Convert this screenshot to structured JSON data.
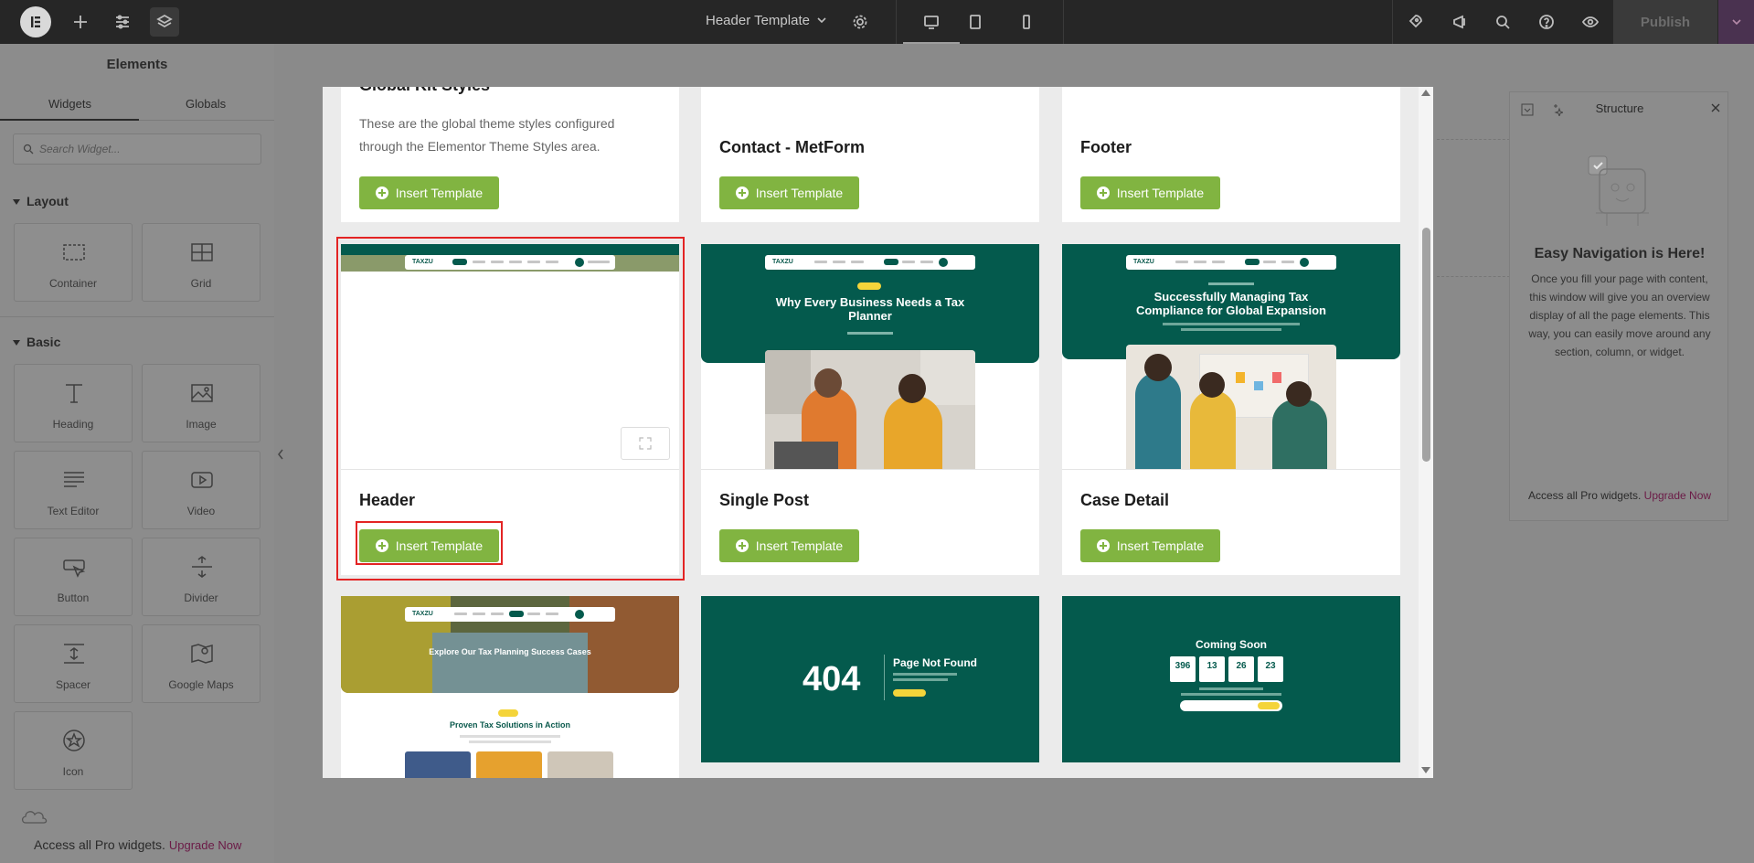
{
  "topbar": {
    "title": "Header Template",
    "publish_label": "Publish"
  },
  "left_panel": {
    "title": "Elements",
    "tabs": [
      "Widgets",
      "Globals"
    ],
    "search_placeholder": "Search Widget...",
    "sections": {
      "layout": "Layout",
      "basic": "Basic"
    },
    "layout_widgets": [
      {
        "label": "Container",
        "icon": "container-icon"
      },
      {
        "label": "Grid",
        "icon": "grid-icon"
      }
    ],
    "basic_widgets": [
      {
        "label": "Heading",
        "icon": "heading-icon"
      },
      {
        "label": "Image",
        "icon": "image-icon"
      },
      {
        "label": "Text Editor",
        "icon": "text-editor-icon"
      },
      {
        "label": "Video",
        "icon": "video-icon"
      },
      {
        "label": "Button",
        "icon": "button-icon"
      },
      {
        "label": "Divider",
        "icon": "divider-icon"
      },
      {
        "label": "Spacer",
        "icon": "spacer-icon"
      },
      {
        "label": "Google Maps",
        "icon": "map-icon"
      },
      {
        "label": "Icon",
        "icon": "star-icon"
      }
    ],
    "pro_text": "Access all Pro widgets.",
    "pro_link": "Upgrade Now"
  },
  "structure_panel": {
    "title": "Structure",
    "heading": "Easy Navigation is Here!",
    "body": "Once you fill your page with content, this window will give you an overview display of all the page elements. This way, you can easily move around any section, column, or widget.",
    "pro_text": "Access all Pro widgets.",
    "pro_link": "Upgrade Now"
  },
  "modal": {
    "insert_label": "Insert Template",
    "cards": [
      {
        "title": "Global Kit Styles",
        "desc": "These are the global theme styles configured through the Elementor Theme Styles area."
      },
      {
        "title": "Contact - MetForm"
      },
      {
        "title": "Footer"
      },
      {
        "title": "Header"
      },
      {
        "title": "Single Post"
      },
      {
        "title": "Case Detail"
      }
    ],
    "thumbnails": {
      "single_post_heading": "Why Every Business Needs a Tax Planner",
      "case_detail_heading": "Successfully Managing Tax Compliance for Global Expansion",
      "cases_heading": "Explore Our Tax Planning Success Cases",
      "cases_subheading": "Proven Tax Solutions in Action",
      "notfound_code": "404",
      "notfound_title": "Page Not Found",
      "coming_soon_title": "Coming Soon",
      "countdown": [
        "396",
        "13",
        "26",
        "23"
      ],
      "logo": "TAXZU"
    }
  },
  "colors": {
    "accent_green": "#81b441",
    "teal": "#045a4d",
    "highlight_red": "#e32424",
    "pro_link": "#6b1a46"
  }
}
